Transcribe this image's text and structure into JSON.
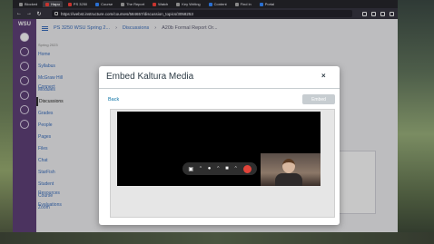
{
  "browser": {
    "tabs": [
      "Blocked",
      "Hapu",
      "PS 3250",
      "Course",
      "The Report",
      "Watch",
      "Key Writing",
      "Content",
      "Find in",
      "Portal"
    ],
    "url": "https://webst.instructure.com/courses/584657/discussion_topics/3058253"
  },
  "canvas": {
    "logo": "WSU",
    "breadcrumbs": [
      "PS 3250 WSU Spring 2...",
      "Discussions",
      "A20b Formal Report Or..."
    ],
    "course_nav_sub": "Spring 2023",
    "course_nav": [
      "Home",
      "Syllabus",
      "McGraw Hill Connect",
      "Modules",
      "Discussions",
      "Grades",
      "People",
      "Pages",
      "Files",
      "Chat",
      "StarFish",
      "Student Resources",
      "Course Evaluations",
      "Zoom"
    ]
  },
  "modal": {
    "title": "Embed Kaltura Media",
    "close_label": "×",
    "back_label": "Back",
    "embed_label": "Embed"
  },
  "recorder": {
    "camera_icon": "camera-icon",
    "mic_icon": "microphone-icon",
    "screen_icon": "screen-share-icon",
    "caret": "^",
    "record_color": "#e2443a"
  }
}
